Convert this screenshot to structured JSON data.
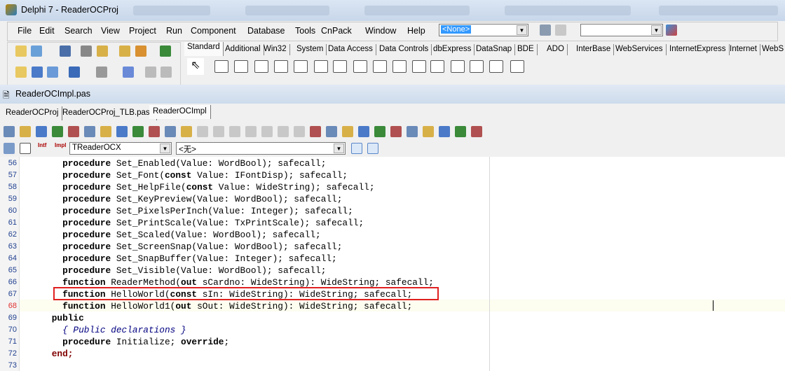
{
  "window": {
    "title": "Delphi 7 - ReaderOCProj"
  },
  "menu": [
    "File",
    "Edit",
    "Search",
    "View",
    "Project",
    "Run",
    "Component",
    "Database",
    "Tools",
    "CnPack",
    "Window",
    "Help"
  ],
  "desktop_combo": {
    "value": "<None>"
  },
  "palette_tabs": [
    "Standard",
    "Additional",
    "Win32",
    "System",
    "Data Access",
    "Data Controls",
    "dbExpress",
    "DataSnap",
    "BDE",
    "ADO",
    "InterBase",
    "WebServices",
    "InternetExpress",
    "Internet",
    "WebS"
  ],
  "editor": {
    "title": "ReaderOCImpl.pas",
    "file_tabs": [
      "ReaderOCProj",
      "ReaderOCProj_TLB.pas*",
      "ReaderOCImpl"
    ],
    "active_tab": 2,
    "class_combo": "TReaderOCX",
    "method_combo": "<无>",
    "intf_label": "Intf",
    "impl_label": "Impl",
    "current_line": 68,
    "highlighted_line": 67,
    "lines": [
      {
        "n": "56",
        "code": "      procedure Set_Enabled(Value: WordBool); safecall;"
      },
      {
        "n": "57",
        "code": "      procedure Set_Font(const Value: IFontDisp); safecall;"
      },
      {
        "n": "58",
        "code": "      procedure Set_HelpFile(const Value: WideString); safecall;"
      },
      {
        "n": "59",
        "code": "      procedure Set_KeyPreview(Value: WordBool); safecall;"
      },
      {
        "n": "60",
        "code": "      procedure Set_PixelsPerInch(Value: Integer); safecall;"
      },
      {
        "n": "61",
        "code": "      procedure Set_PrintScale(Value: TxPrintScale); safecall;"
      },
      {
        "n": "62",
        "code": "      procedure Set_Scaled(Value: WordBool); safecall;"
      },
      {
        "n": "63",
        "code": "      procedure Set_ScreenSnap(Value: WordBool); safecall;"
      },
      {
        "n": "64",
        "code": "      procedure Set_SnapBuffer(Value: Integer); safecall;"
      },
      {
        "n": "65",
        "code": "      procedure Set_Visible(Value: WordBool); safecall;"
      },
      {
        "n": "66",
        "code": "      function ReaderMethod(out sCardno: WideString): WideString; safecall;"
      },
      {
        "n": "67",
        "code": "      function HelloWorld(const sIn: WideString): WideString; safecall;"
      },
      {
        "n": "68",
        "code": "      function HelloWorld1(out sOut: WideString): WideString; safecall;"
      },
      {
        "n": "69",
        "code": "    public"
      },
      {
        "n": "70",
        "code": "      { Public declarations }"
      },
      {
        "n": "71",
        "code": "      procedure Initialize; override;"
      },
      {
        "n": "72",
        "code": "    end;"
      },
      {
        "n": "73",
        "code": ""
      }
    ]
  },
  "colors": {
    "line_number": "#1f3f8f",
    "current_line_number": "#e03030",
    "highlight_box": "#e02020",
    "current_line_bg": "#fdfdf0",
    "comment": "#000080"
  }
}
